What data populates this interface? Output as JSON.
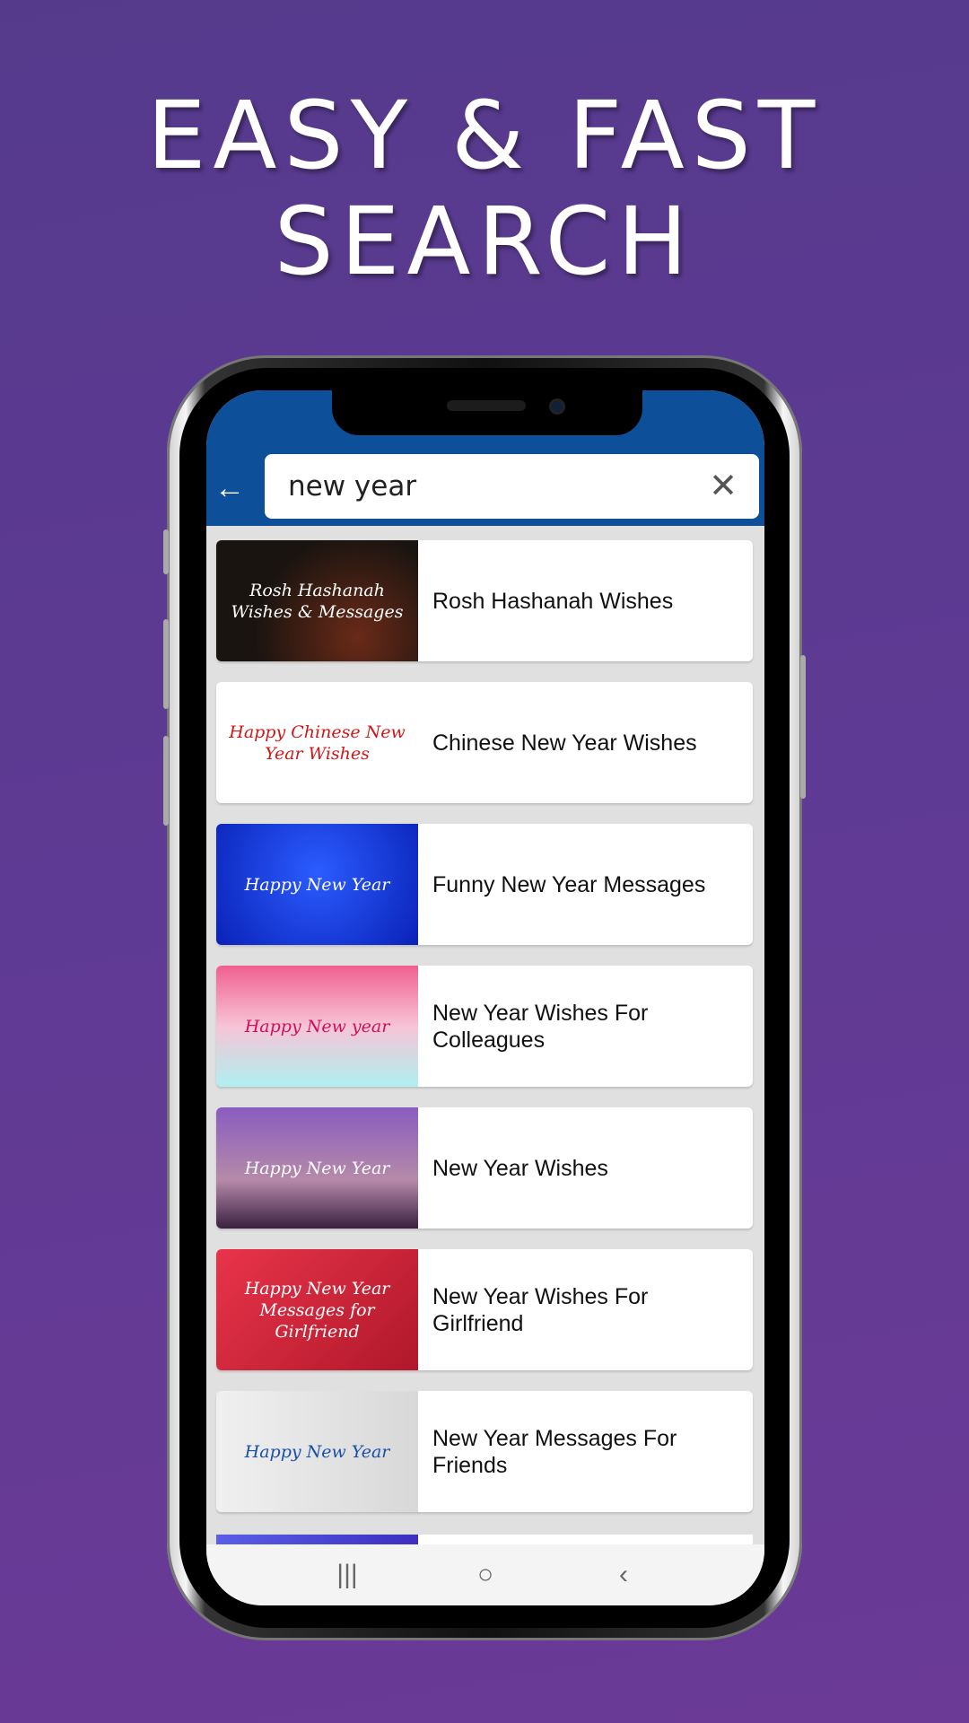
{
  "headline": {
    "line1": "EASY & FAST",
    "line2": "SEARCH"
  },
  "search": {
    "value": "new year",
    "back_icon": "arrow-left-icon",
    "clear_icon": "close-icon"
  },
  "results": [
    {
      "title": "Rosh Hashanah Wishes",
      "thumb_text": "Rosh Hashanah Wishes & Messages",
      "bg": "#1a1410"
    },
    {
      "title": "Chinese New Year Wishes",
      "thumb_text": "Happy Chinese New Year Wishes",
      "bg": "#ffffff"
    },
    {
      "title": "Funny New Year Messages",
      "thumb_text": "Happy New Year",
      "bg": "#1237d8"
    },
    {
      "title": "New Year Wishes For Colleagues",
      "thumb_text": "Happy New year",
      "bg": "#f4a6c0"
    },
    {
      "title": "New Year Wishes",
      "thumb_text": "Happy New Year",
      "bg": "#7a4fa6"
    },
    {
      "title": "New Year Wishes For Girlfriend",
      "thumb_text": "Happy New Year Messages for Girlfriend",
      "bg": "#d42a3a"
    },
    {
      "title": "New Year Messages For Friends",
      "thumb_text": "Happy New Year",
      "bg": "#e4e4e4"
    }
  ],
  "nav": {
    "recents": "|||",
    "home": "○",
    "back": "‹"
  },
  "colors": {
    "toolbar": "#0d4f98",
    "background": "#5f3a94"
  }
}
